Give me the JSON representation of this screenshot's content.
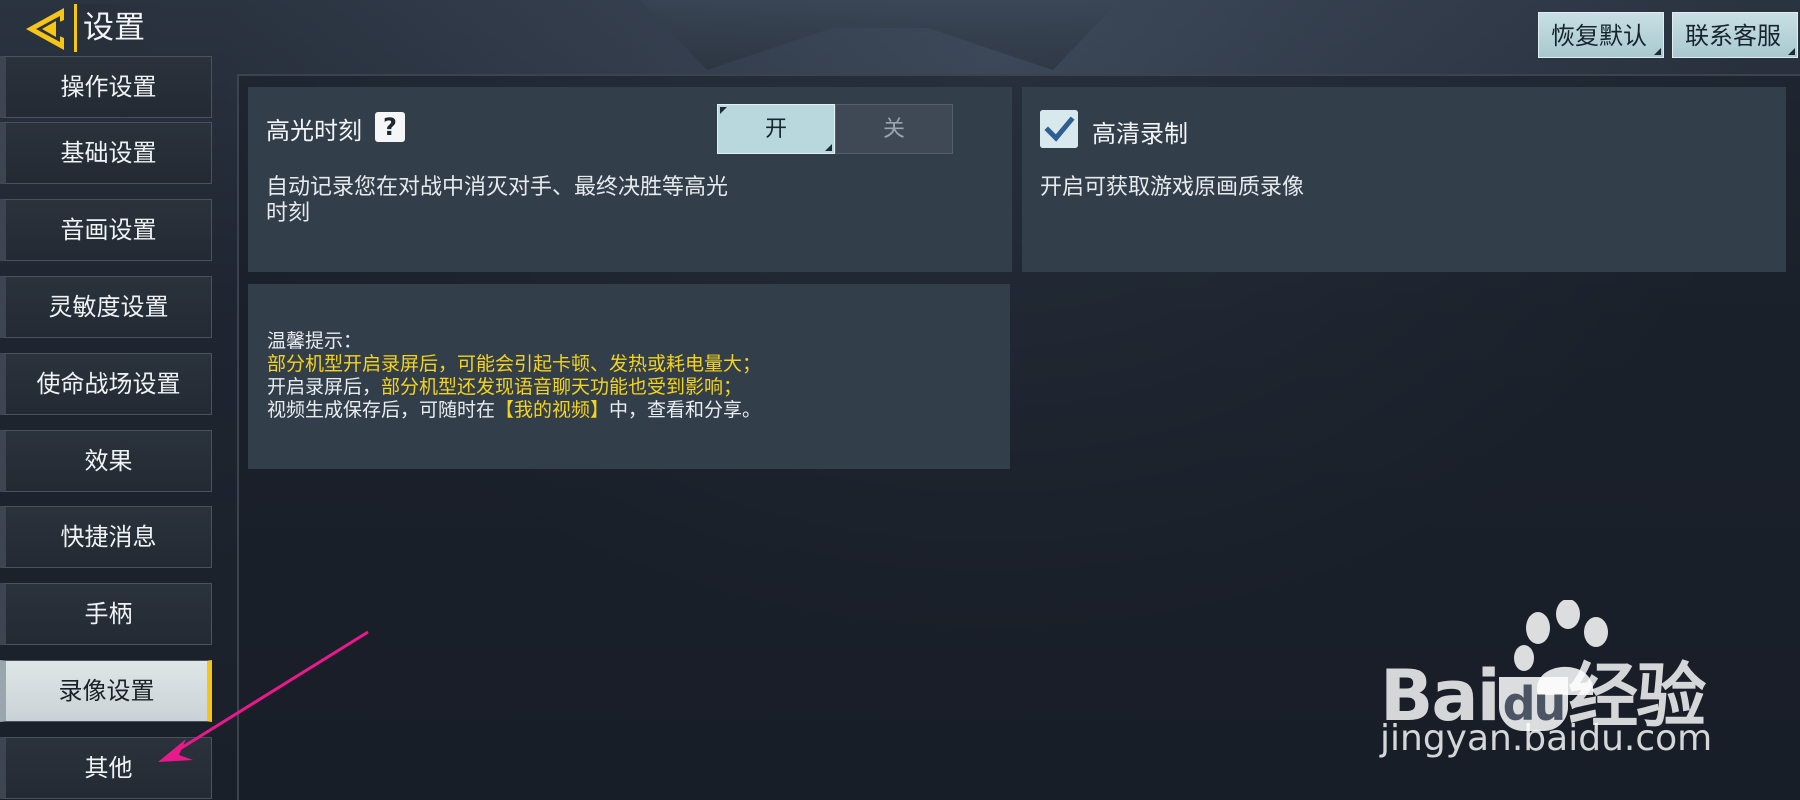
{
  "header": {
    "title": "设置",
    "restore_default": "恢复默认",
    "contact_support": "联系客服"
  },
  "sidebar": {
    "items": [
      {
        "label": "操作设置"
      },
      {
        "label": "基础设置"
      },
      {
        "label": "音画设置"
      },
      {
        "label": "灵敏度设置"
      },
      {
        "label": "使命战场设置"
      },
      {
        "label": "效果"
      },
      {
        "label": "快捷消息"
      },
      {
        "label": "手柄"
      },
      {
        "label": "录像设置",
        "active": true
      },
      {
        "label": "其他"
      }
    ]
  },
  "highlight": {
    "title": "高光时刻",
    "help": "?",
    "toggle_on": "开",
    "toggle_off": "关",
    "selected": "开",
    "desc_line1": "自动记录您在对战中消灭对手、最终决胜等高光",
    "desc_line2": "时刻"
  },
  "hd_record": {
    "title": "高清录制",
    "checked": true,
    "desc": "开启可获取游戏原画质录像"
  },
  "tips": {
    "heading": "温馨提示：",
    "line1": "部分机型开启录屏后，可能会引起卡顿、发热或耗电量大；",
    "line2_prefix": "开启录屏后，",
    "line2_highlight": "部分机型还发现语音聊天功能也受到影响；",
    "line3_prefix": "视频生成保存后，可随时在",
    "line3_highlight": "【我的视频】",
    "line3_suffix": "中，查看和分享。"
  },
  "colors": {
    "accent_yellow": "#f5c518",
    "tip_yellow": "#f3d31c",
    "toggle_active": "#b8d8de",
    "arrow": "#e8198b"
  },
  "watermark": {
    "brand_left": "Bai",
    "brand_mid": "du",
    "brand_right": "经验",
    "url": "jingyan.baidu.com"
  }
}
